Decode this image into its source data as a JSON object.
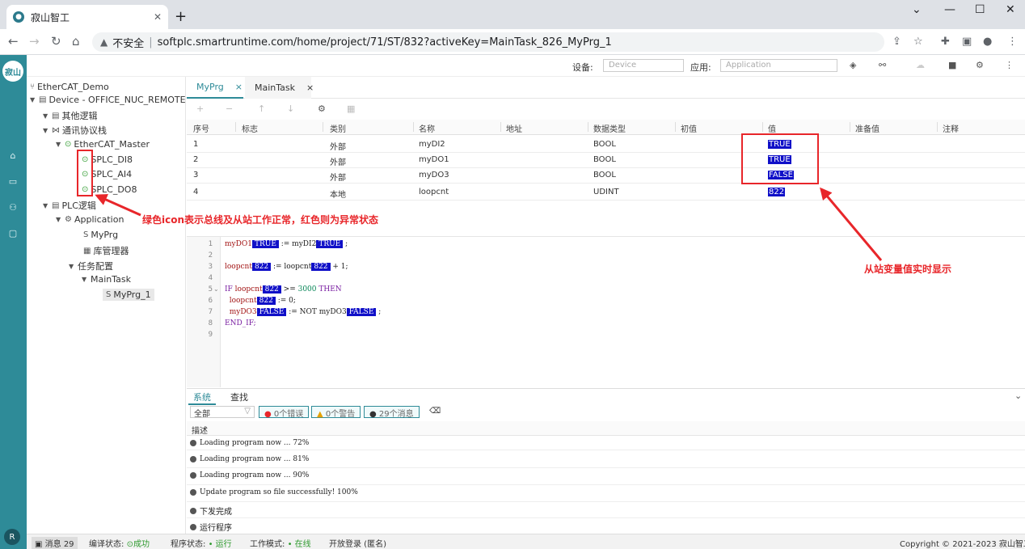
{
  "browser": {
    "tab_title": "寂山智工",
    "tab_close": "✕",
    "new_tab": "+",
    "security_label": "不安全",
    "url": "softplc.smartruntime.com/home/project/71/ST/832?activeKey=MainTask_826_MyPrg_1"
  },
  "topbar": {
    "device_label": "设备:",
    "device_value": "Device",
    "app_label": "应用:",
    "app_value": "Application"
  },
  "rail": {
    "logo": "寂山",
    "avatar": "R"
  },
  "tree": {
    "root": "EtherCAT_Demo",
    "device": "Device - OFFICE_NUC_REMOTE",
    "other_logic": "其他逻辑",
    "comm_bus": "通讯协议栈",
    "master": "EtherCAT_Master",
    "slaves": [
      "SPLC_DI8",
      "SPLC_AI4",
      "SPLC_DO8"
    ],
    "plc_logic": "PLC逻辑",
    "application": "Application",
    "myprg": "MyPrg",
    "lib_manager": "库管理器",
    "task_config": "任务配置",
    "maintask": "MainTask",
    "myprg1": "MyPrg_1"
  },
  "editor_tabs": [
    {
      "label": "MyPrg",
      "close": "×"
    },
    {
      "label": "MainTask",
      "close": "×"
    }
  ],
  "var_table": {
    "headers": [
      "序号",
      "标志",
      "类别",
      "名称",
      "地址",
      "数据类型",
      "初值",
      "值",
      "准备值",
      "注释"
    ],
    "rows": [
      {
        "idx": "1",
        "cat": "外部",
        "name": "myDI2",
        "type": "BOOL",
        "value": "TRUE"
      },
      {
        "idx": "2",
        "cat": "外部",
        "name": "myDO1",
        "type": "BOOL",
        "value": "TRUE"
      },
      {
        "idx": "3",
        "cat": "外部",
        "name": "myDO3",
        "type": "BOOL",
        "value": "FALSE"
      },
      {
        "idx": "4",
        "cat": "本地",
        "name": "loopcnt",
        "type": "UDINT",
        "value": "822"
      }
    ]
  },
  "code": {
    "line_numbers": [
      "1",
      "2",
      "3",
      "4",
      "5",
      "6",
      "7",
      "8",
      "9"
    ],
    "l1": {
      "a": "myDO1",
      "m1": "TRUE",
      "b": " := myDI2",
      "m2": "TRUE",
      "c": " ;"
    },
    "l3": {
      "a": "loopcnt",
      "m1": "822",
      "b": " := loopcnt",
      "m2": "822",
      "c": " + 1;"
    },
    "l5": {
      "kw": "IF",
      "a": " loopcnt",
      "m1": "822",
      "b": " >= ",
      "n": "3000",
      "kw2": " THEN"
    },
    "l6": {
      "a": "  loopcnt",
      "m1": "822",
      "b": " := 0;"
    },
    "l7": {
      "a": "  myDO3",
      "m1": "FALSE",
      "b": " := NOT myDO3",
      "m2": "FALSE",
      "c": " ;"
    },
    "l8": "END_IF;"
  },
  "bottom": {
    "tab_system": "系统",
    "tab_find": "查找",
    "filter": "全部",
    "errors": "0个错误",
    "warnings": "0个警告",
    "messages": "29个消息",
    "desc_header": "描述",
    "logs": [
      "Loading program now ... 72%",
      "Loading program now ... 81%",
      "Loading program now ... 90%",
      "Update program so file successfully! 100%",
      "下发完成",
      "运行程序"
    ]
  },
  "status": {
    "msg": "消息 29",
    "compile_label": "编译状态:",
    "compile_value": "成功",
    "prog_label": "程序状态:",
    "prog_value": "运行",
    "mode_label": "工作模式:",
    "mode_value": "在线",
    "login": "开放登录 (匿名)",
    "copyright": "Copyright © 2021-2023 寂山智工"
  },
  "annotations": {
    "left": "绿色icon表示总线及从站工作正常，红色则为异常状态",
    "right": "从站变量值实时显示"
  },
  "colors": {
    "accent": "#2e8b98",
    "annotation": "#e8262a",
    "monitor": "#1010c8"
  }
}
